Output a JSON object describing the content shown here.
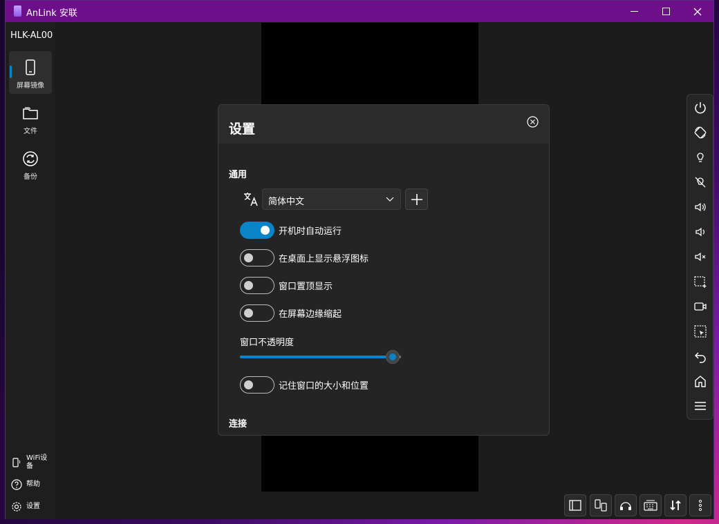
{
  "window": {
    "title": "AnLink 安联"
  },
  "sidebar": {
    "device_name": "HLK-AL00",
    "items": [
      {
        "label": "屏幕镜像",
        "icon": "phone-icon",
        "active": true
      },
      {
        "label": "文件",
        "icon": "folder-icon",
        "active": false
      },
      {
        "label": "备份",
        "icon": "sync-icon",
        "active": false
      }
    ],
    "bottom_items": [
      {
        "label": "WiFi设备",
        "icon": "wifi-phone-icon"
      },
      {
        "label": "帮助",
        "icon": "help-icon"
      },
      {
        "label": "设置",
        "icon": "gear-icon"
      }
    ]
  },
  "settings_dialog": {
    "title": "设置",
    "general_section": "通用",
    "language": {
      "selected": "简体中文"
    },
    "toggles": [
      {
        "key": "auto_start",
        "label": "开机时自动运行",
        "on": true
      },
      {
        "key": "floating_icon",
        "label": "在桌面上显示悬浮图标",
        "on": false
      },
      {
        "key": "always_on_top",
        "label": "窗口置顶显示",
        "on": false
      },
      {
        "key": "edge_collapse",
        "label": "在屏幕边缘缩起",
        "on": false
      }
    ],
    "opacity": {
      "label": "窗口不透明度",
      "value_fraction": 0.95
    },
    "remember_window": {
      "label": "记住窗口的大小和位置",
      "on": false
    },
    "connection_section": "连接"
  },
  "right_toolbar": [
    "power-icon",
    "rotate-icon",
    "light-bulb-icon",
    "light-off-icon",
    "volume-up-icon",
    "volume-down-icon",
    "mute-icon",
    "screenshot-region-icon",
    "record-video-icon",
    "select-region-icon",
    "back-icon",
    "home-icon",
    "menu-icon"
  ],
  "bottom_toolbar": [
    "layout-icon",
    "device-connect-icon",
    "headset-icon",
    "keyboard-icon",
    "transfer-icon",
    "more-icon"
  ],
  "colors": {
    "accent": "#0a84c8",
    "titlebar": "#6e0f8a"
  }
}
